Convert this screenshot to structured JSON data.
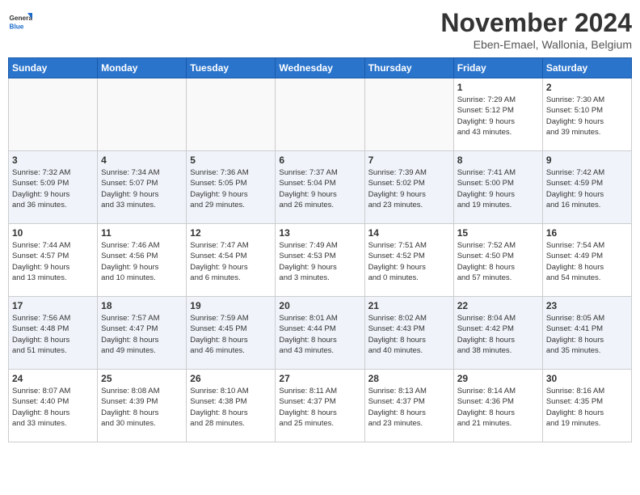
{
  "logo": {
    "general": "General",
    "blue": "Blue"
  },
  "title": "November 2024",
  "location": "Eben-Emael, Wallonia, Belgium",
  "days_of_week": [
    "Sunday",
    "Monday",
    "Tuesday",
    "Wednesday",
    "Thursday",
    "Friday",
    "Saturday"
  ],
  "weeks": [
    [
      {
        "day": "",
        "info": ""
      },
      {
        "day": "",
        "info": ""
      },
      {
        "day": "",
        "info": ""
      },
      {
        "day": "",
        "info": ""
      },
      {
        "day": "",
        "info": ""
      },
      {
        "day": "1",
        "info": "Sunrise: 7:29 AM\nSunset: 5:12 PM\nDaylight: 9 hours\nand 43 minutes."
      },
      {
        "day": "2",
        "info": "Sunrise: 7:30 AM\nSunset: 5:10 PM\nDaylight: 9 hours\nand 39 minutes."
      }
    ],
    [
      {
        "day": "3",
        "info": "Sunrise: 7:32 AM\nSunset: 5:09 PM\nDaylight: 9 hours\nand 36 minutes."
      },
      {
        "day": "4",
        "info": "Sunrise: 7:34 AM\nSunset: 5:07 PM\nDaylight: 9 hours\nand 33 minutes."
      },
      {
        "day": "5",
        "info": "Sunrise: 7:36 AM\nSunset: 5:05 PM\nDaylight: 9 hours\nand 29 minutes."
      },
      {
        "day": "6",
        "info": "Sunrise: 7:37 AM\nSunset: 5:04 PM\nDaylight: 9 hours\nand 26 minutes."
      },
      {
        "day": "7",
        "info": "Sunrise: 7:39 AM\nSunset: 5:02 PM\nDaylight: 9 hours\nand 23 minutes."
      },
      {
        "day": "8",
        "info": "Sunrise: 7:41 AM\nSunset: 5:00 PM\nDaylight: 9 hours\nand 19 minutes."
      },
      {
        "day": "9",
        "info": "Sunrise: 7:42 AM\nSunset: 4:59 PM\nDaylight: 9 hours\nand 16 minutes."
      }
    ],
    [
      {
        "day": "10",
        "info": "Sunrise: 7:44 AM\nSunset: 4:57 PM\nDaylight: 9 hours\nand 13 minutes."
      },
      {
        "day": "11",
        "info": "Sunrise: 7:46 AM\nSunset: 4:56 PM\nDaylight: 9 hours\nand 10 minutes."
      },
      {
        "day": "12",
        "info": "Sunrise: 7:47 AM\nSunset: 4:54 PM\nDaylight: 9 hours\nand 6 minutes."
      },
      {
        "day": "13",
        "info": "Sunrise: 7:49 AM\nSunset: 4:53 PM\nDaylight: 9 hours\nand 3 minutes."
      },
      {
        "day": "14",
        "info": "Sunrise: 7:51 AM\nSunset: 4:52 PM\nDaylight: 9 hours\nand 0 minutes."
      },
      {
        "day": "15",
        "info": "Sunrise: 7:52 AM\nSunset: 4:50 PM\nDaylight: 8 hours\nand 57 minutes."
      },
      {
        "day": "16",
        "info": "Sunrise: 7:54 AM\nSunset: 4:49 PM\nDaylight: 8 hours\nand 54 minutes."
      }
    ],
    [
      {
        "day": "17",
        "info": "Sunrise: 7:56 AM\nSunset: 4:48 PM\nDaylight: 8 hours\nand 51 minutes."
      },
      {
        "day": "18",
        "info": "Sunrise: 7:57 AM\nSunset: 4:47 PM\nDaylight: 8 hours\nand 49 minutes."
      },
      {
        "day": "19",
        "info": "Sunrise: 7:59 AM\nSunset: 4:45 PM\nDaylight: 8 hours\nand 46 minutes."
      },
      {
        "day": "20",
        "info": "Sunrise: 8:01 AM\nSunset: 4:44 PM\nDaylight: 8 hours\nand 43 minutes."
      },
      {
        "day": "21",
        "info": "Sunrise: 8:02 AM\nSunset: 4:43 PM\nDaylight: 8 hours\nand 40 minutes."
      },
      {
        "day": "22",
        "info": "Sunrise: 8:04 AM\nSunset: 4:42 PM\nDaylight: 8 hours\nand 38 minutes."
      },
      {
        "day": "23",
        "info": "Sunrise: 8:05 AM\nSunset: 4:41 PM\nDaylight: 8 hours\nand 35 minutes."
      }
    ],
    [
      {
        "day": "24",
        "info": "Sunrise: 8:07 AM\nSunset: 4:40 PM\nDaylight: 8 hours\nand 33 minutes."
      },
      {
        "day": "25",
        "info": "Sunrise: 8:08 AM\nSunset: 4:39 PM\nDaylight: 8 hours\nand 30 minutes."
      },
      {
        "day": "26",
        "info": "Sunrise: 8:10 AM\nSunset: 4:38 PM\nDaylight: 8 hours\nand 28 minutes."
      },
      {
        "day": "27",
        "info": "Sunrise: 8:11 AM\nSunset: 4:37 PM\nDaylight: 8 hours\nand 25 minutes."
      },
      {
        "day": "28",
        "info": "Sunrise: 8:13 AM\nSunset: 4:37 PM\nDaylight: 8 hours\nand 23 minutes."
      },
      {
        "day": "29",
        "info": "Sunrise: 8:14 AM\nSunset: 4:36 PM\nDaylight: 8 hours\nand 21 minutes."
      },
      {
        "day": "30",
        "info": "Sunrise: 8:16 AM\nSunset: 4:35 PM\nDaylight: 8 hours\nand 19 minutes."
      }
    ]
  ]
}
